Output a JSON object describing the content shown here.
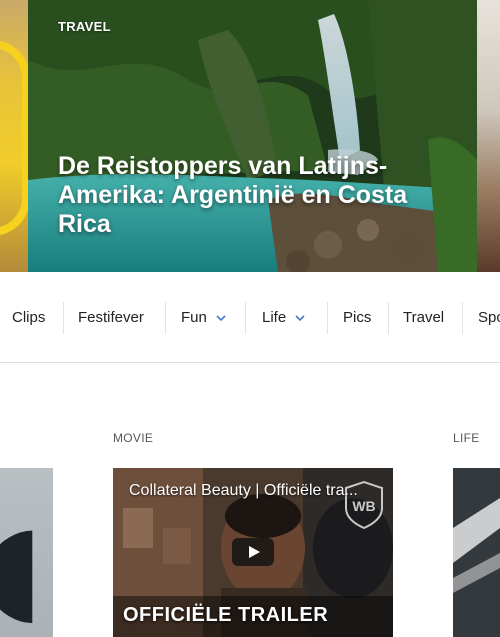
{
  "hero": {
    "category": "TRAVEL",
    "title": "De Reistoppers van Latijns-Amerika: Argentinië en Costa Rica"
  },
  "nav": {
    "items": [
      {
        "label": "Clips",
        "dropdown": false
      },
      {
        "label": "Festifever",
        "dropdown": false
      },
      {
        "label": "Fun",
        "dropdown": true
      },
      {
        "label": "Life",
        "dropdown": true
      },
      {
        "label": "Pics",
        "dropdown": false
      },
      {
        "label": "Travel",
        "dropdown": false
      },
      {
        "label": "Spo",
        "dropdown": false
      }
    ]
  },
  "cards": {
    "center": {
      "category": "MOVIE",
      "video_title": "Collateral Beauty | Officiële tra...",
      "video_caption": "OFFICIËLE TRAILER"
    },
    "right": {
      "category": "LIFE"
    }
  },
  "colors": {
    "accent_blue": "#4a76c9",
    "text": "#222222",
    "label": "#555555"
  }
}
